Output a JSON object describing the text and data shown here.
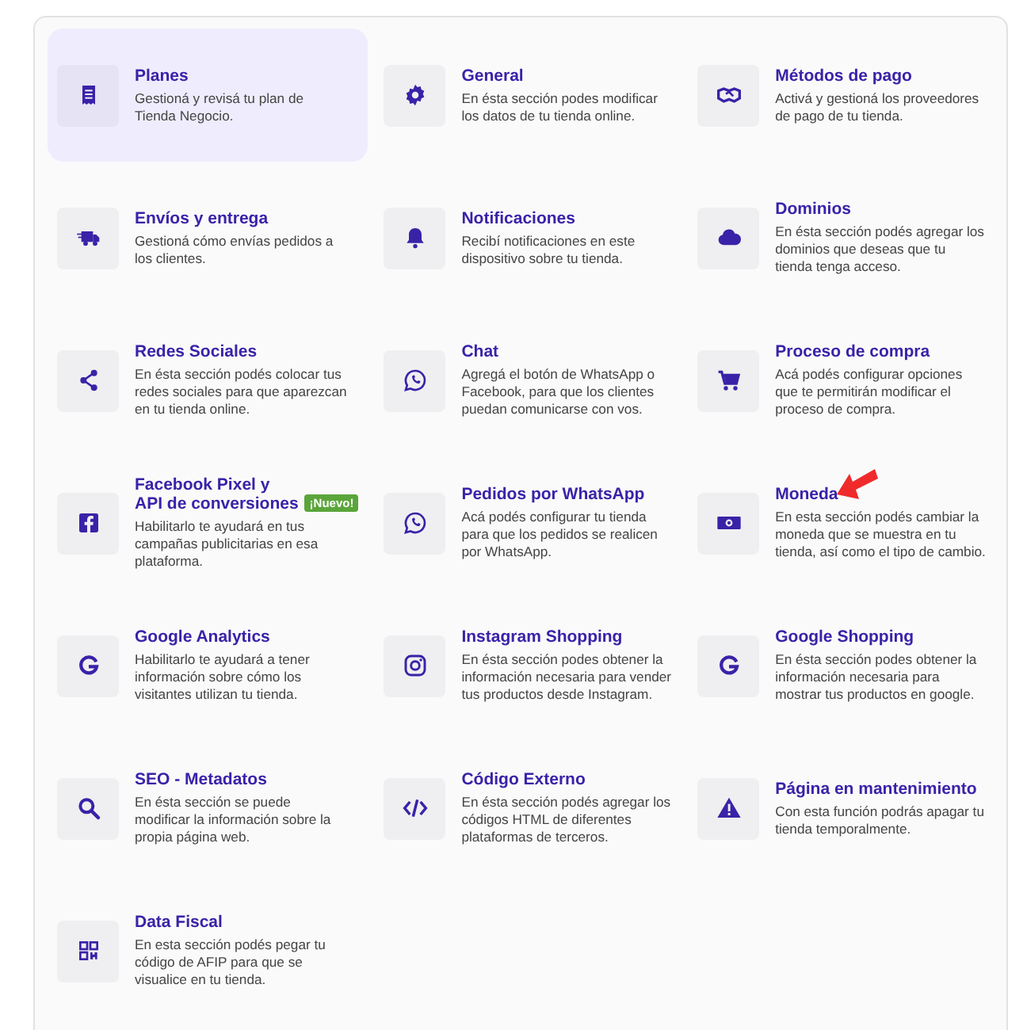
{
  "sections": [
    {
      "title_lines": [
        "Planes"
      ],
      "description": "Gestioná y revisá tu plan de Tienda Negocio.",
      "selected": true
    },
    {
      "title_lines": [
        "General"
      ],
      "description": "En ésta sección podes modificar los datos de tu tienda online.",
      "selected": false
    },
    {
      "title_lines": [
        "Métodos de pago"
      ],
      "description": "Activá y gestioná los proveedores de pago de tu tienda.",
      "selected": false
    },
    {
      "title_lines": [
        "Envíos y entrega"
      ],
      "description": "Gestioná cómo envías pedidos a los clientes.",
      "selected": false
    },
    {
      "title_lines": [
        "Notificaciones"
      ],
      "description": "Recibí notificaciones en este dispositivo sobre tu tienda.",
      "selected": false
    },
    {
      "title_lines": [
        "Dominios"
      ],
      "description": "En ésta sección podés agregar los dominios que deseas que tu tienda tenga acceso.",
      "selected": false
    },
    {
      "title_lines": [
        "Redes Sociales"
      ],
      "description": "En ésta sección podés colocar tus redes sociales para que aparezcan en tu tienda online.",
      "selected": false
    },
    {
      "title_lines": [
        "Chat"
      ],
      "description": "Agregá el botón de WhatsApp o Facebook, para que los clientes puedan comunicarse con vos.",
      "selected": false
    },
    {
      "title_lines": [
        "Proceso de compra"
      ],
      "description": "Acá podés configurar opciones que te permitirán modificar el proceso de compra.",
      "selected": false
    },
    {
      "title_lines": [
        "Facebook Pixel y",
        "API de conversiones"
      ],
      "badge": "¡Nuevo!",
      "description": "Habilitarlo te ayudará en tus campañas publicitarias en esa plataforma.",
      "selected": false
    },
    {
      "title_lines": [
        "Pedidos por WhatsApp"
      ],
      "description": "Acá podés configurar tu tienda para que los pedidos se realicen por WhatsApp.",
      "selected": false
    },
    {
      "title_lines": [
        "Moneda"
      ],
      "description": "En esta sección podés cambiar la moneda que se muestra en tu tienda, así como el tipo de cambio.",
      "selected": false,
      "annotated": true
    },
    {
      "title_lines": [
        "Google Analytics"
      ],
      "description": "Habilitarlo te ayudará a tener información sobre cómo los visitantes utilizan tu tienda.",
      "selected": false
    },
    {
      "title_lines": [
        "Instagram Shopping"
      ],
      "description": "En ésta sección podes obtener la información necesaria para vender tus productos desde Instagram.",
      "selected": false
    },
    {
      "title_lines": [
        "Google Shopping"
      ],
      "description": "En ésta sección podes obtener la información necesaria para mostrar tus productos en google.",
      "selected": false
    },
    {
      "title_lines": [
        "SEO - Metadatos"
      ],
      "description": "En ésta sección se puede modificar la información sobre la propia página web.",
      "selected": false
    },
    {
      "title_lines": [
        "Código Externo"
      ],
      "description": "En ésta sección podés agregar los códigos HTML de diferentes plataformas de terceros.",
      "selected": false
    },
    {
      "title_lines": [
        "Página en mantenimiento"
      ],
      "description": "Con esta función podrás apagar tu tienda temporalmente.",
      "selected": false
    },
    {
      "title_lines": [
        "Data Fiscal"
      ],
      "description": "En esta sección podés pegar tu código de AFIP para que se visualice en tu tienda.",
      "selected": false
    }
  ]
}
